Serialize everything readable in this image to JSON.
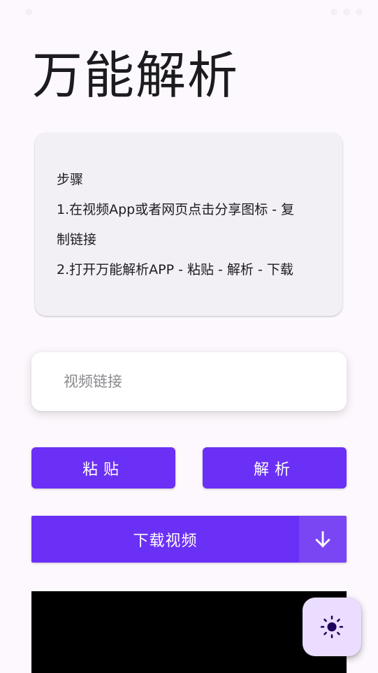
{
  "app": {
    "title": "万能解析"
  },
  "steps": {
    "heading": "步骤",
    "step1_line1": "1.在视频App或者网页点击分享图标 - 复",
    "step1_line2": "制链接",
    "step2": "2.打开万能解析APP - 粘贴 - 解析 - 下载"
  },
  "link_input": {
    "placeholder": "视频链接",
    "value": ""
  },
  "buttons": {
    "paste_label": "粘贴",
    "parse_label": "解析",
    "download_label": "下载视频"
  },
  "icons": {
    "download_toggle": "arrow-down-icon",
    "theme_fab": "sun-icon"
  },
  "colors": {
    "primary": "#6b30f5",
    "primary_light": "#7a45f3",
    "background": "#fdf8fd",
    "card": "#f3f0f5",
    "fab": "#eaddff",
    "video_bg": "#000000"
  }
}
